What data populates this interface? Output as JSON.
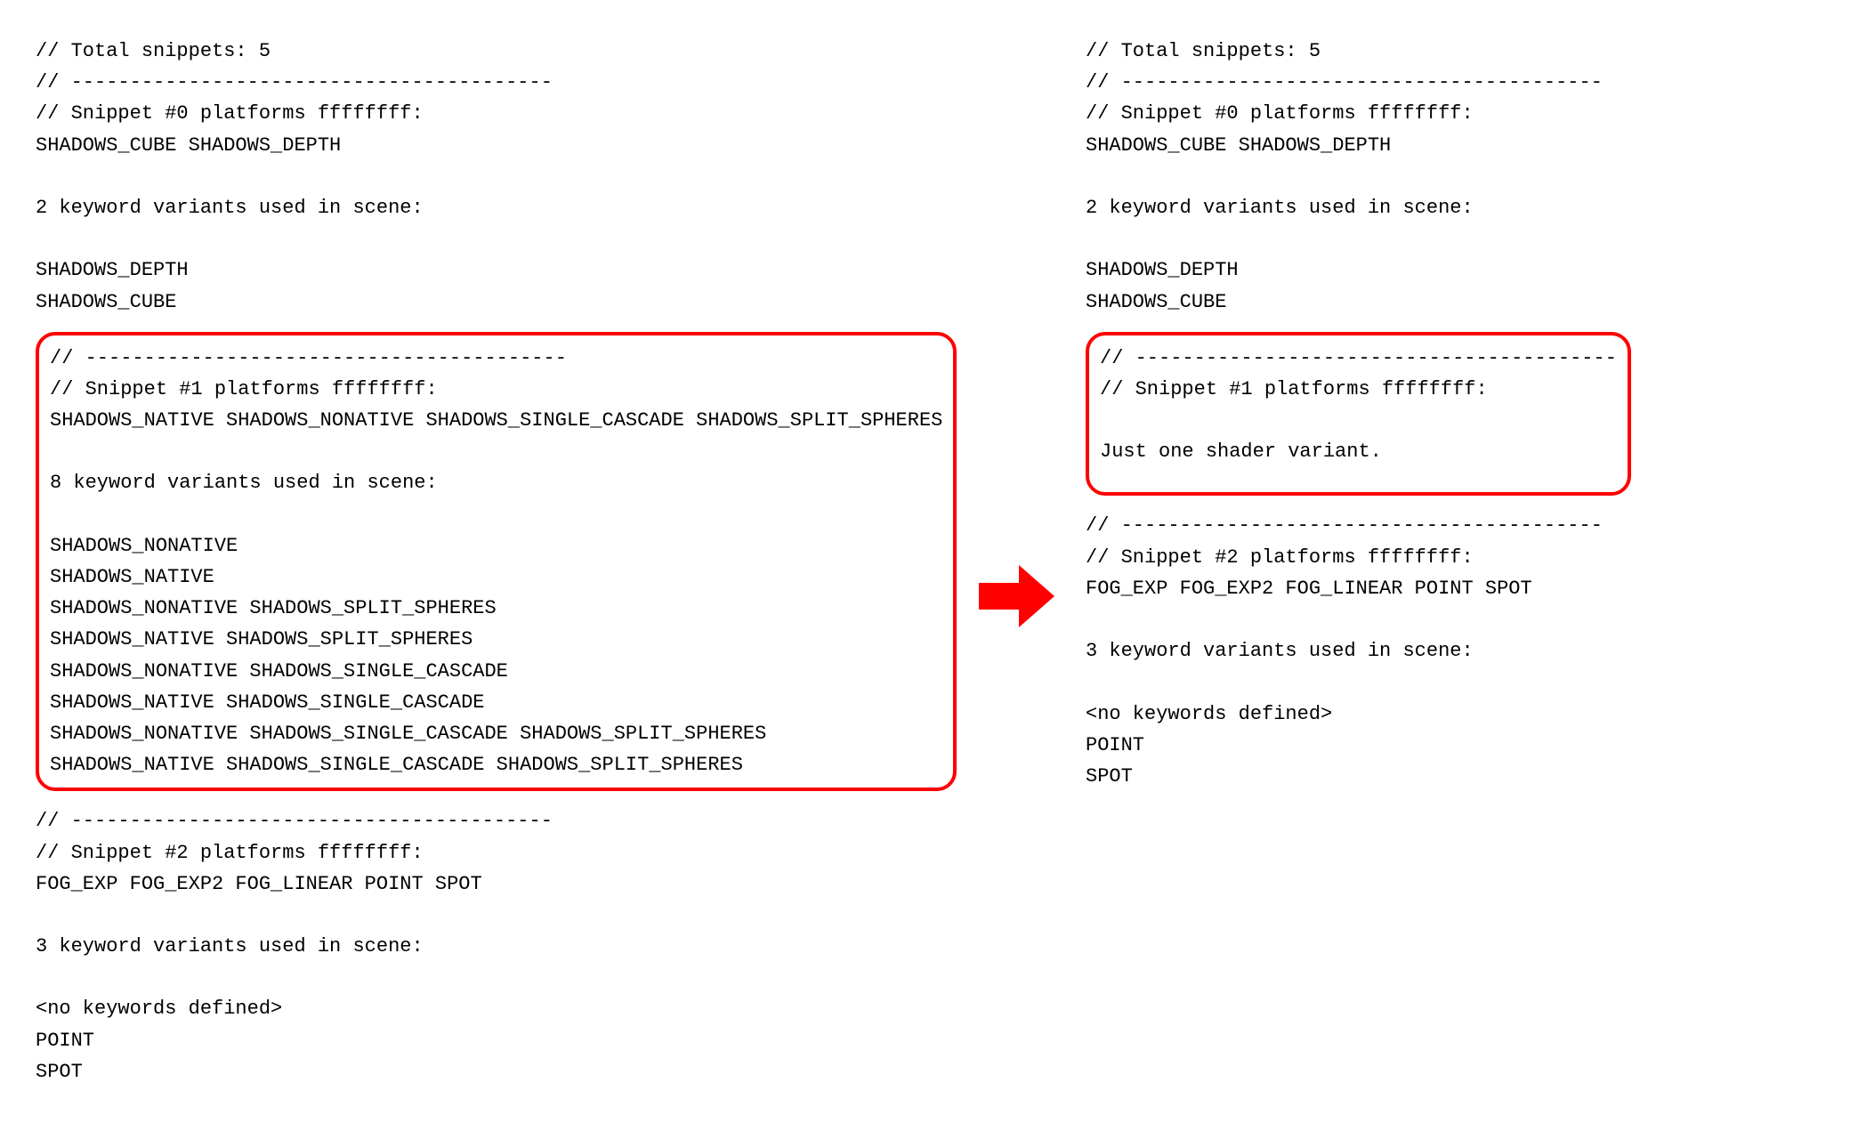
{
  "left": {
    "snippet0": {
      "lines": [
        "// Total snippets: 5",
        "// -----------------------------------------",
        "// Snippet #0 platforms ffffffff:",
        "SHADOWS_CUBE SHADOWS_DEPTH",
        "",
        "2 keyword variants used in scene:",
        "",
        "SHADOWS_DEPTH",
        "SHADOWS_CUBE"
      ]
    },
    "snippet1": {
      "lines": [
        "// -----------------------------------------",
        "// Snippet #1 platforms ffffffff:",
        "SHADOWS_NATIVE SHADOWS_NONATIVE SHADOWS_SINGLE_CASCADE SHADOWS_SPLIT_SPHERES",
        "",
        "8 keyword variants used in scene:",
        "",
        "SHADOWS_NONATIVE",
        "SHADOWS_NATIVE",
        "SHADOWS_NONATIVE SHADOWS_SPLIT_SPHERES",
        "SHADOWS_NATIVE SHADOWS_SPLIT_SPHERES",
        "SHADOWS_NONATIVE SHADOWS_SINGLE_CASCADE",
        "SHADOWS_NATIVE SHADOWS_SINGLE_CASCADE",
        "SHADOWS_NONATIVE SHADOWS_SINGLE_CASCADE SHADOWS_SPLIT_SPHERES",
        "SHADOWS_NATIVE SHADOWS_SINGLE_CASCADE SHADOWS_SPLIT_SPHERES"
      ]
    },
    "snippet2": {
      "lines": [
        "// -----------------------------------------",
        "// Snippet #2 platforms ffffffff:",
        "FOG_EXP FOG_EXP2 FOG_LINEAR POINT SPOT",
        "",
        "3 keyword variants used in scene:",
        "",
        "<no keywords defined>",
        "POINT",
        "SPOT"
      ]
    }
  },
  "right": {
    "snippet0": {
      "lines": [
        "// Total snippets: 5",
        "// -----------------------------------------",
        "// Snippet #0 platforms ffffffff:",
        "SHADOWS_CUBE SHADOWS_DEPTH",
        "",
        "2 keyword variants used in scene:",
        "",
        "SHADOWS_DEPTH",
        "SHADOWS_CUBE"
      ]
    },
    "snippet1": {
      "lines": [
        "// -----------------------------------------",
        "// Snippet #1 platforms ffffffff:",
        "",
        "Just one shader variant."
      ]
    },
    "snippet2": {
      "lines": [
        "// -----------------------------------------",
        "// Snippet #2 platforms ffffffff:",
        "FOG_EXP FOG_EXP2 FOG_LINEAR POINT SPOT",
        "",
        "3 keyword variants used in scene:",
        "",
        "<no keywords defined>",
        "POINT",
        "SPOT"
      ]
    }
  },
  "colors": {
    "highlight": "#ff0000"
  }
}
